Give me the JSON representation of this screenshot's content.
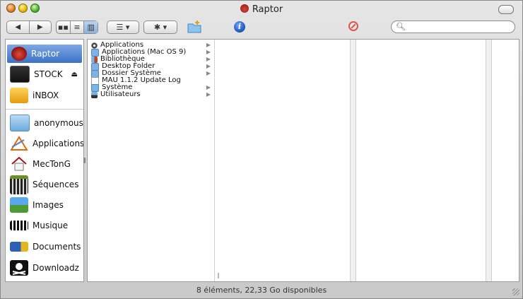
{
  "window": {
    "title": "Raptor"
  },
  "toolbar": {
    "back_icon": "back-arrow-icon",
    "forward_icon": "forward-arrow-icon",
    "view_icons": [
      "icon-view-icon",
      "list-view-icon",
      "column-view-icon"
    ],
    "search": {
      "value": "",
      "placeholder": ""
    }
  },
  "sidebar": {
    "items": [
      {
        "label": "Raptor",
        "icon": "hard-disk-icon",
        "selected": true
      },
      {
        "label": "STOCK",
        "icon": "external-drive-icon",
        "eject": true
      },
      {
        "label": "iNBOX",
        "icon": "inbox-icon"
      },
      {
        "label": "anonymous",
        "icon": "home-folder-icon"
      },
      {
        "label": "Applications",
        "icon": "applications-icon"
      },
      {
        "label": "MecTonG",
        "icon": "home-icon"
      },
      {
        "label": "Séquences",
        "icon": "clapper-icon"
      },
      {
        "label": "Images",
        "icon": "landscape-icon"
      },
      {
        "label": "Musique",
        "icon": "piano-icon"
      },
      {
        "label": "Documents",
        "icon": "documents-icon"
      },
      {
        "label": "Downloadz",
        "icon": "skull-icon"
      }
    ]
  },
  "browser": {
    "column1": [
      {
        "label": "Applications",
        "icon": "applications-folder-icon",
        "has_children": true
      },
      {
        "label": "Applications (Mac OS 9)",
        "icon": "folder-icon",
        "has_children": true
      },
      {
        "label": "Bibliothèque",
        "icon": "library-folder-icon",
        "has_children": true
      },
      {
        "label": "Desktop Folder",
        "icon": "folder-icon",
        "has_children": true
      },
      {
        "label": "Dossier Système",
        "icon": "folder-icon",
        "has_children": true
      },
      {
        "label": "MAU 1.1.2 Update Log",
        "icon": "document-icon",
        "has_children": false
      },
      {
        "label": "Système",
        "icon": "folder-icon",
        "has_children": true
      },
      {
        "label": "Utilisateurs",
        "icon": "users-folder-icon",
        "has_children": true
      }
    ]
  },
  "status": {
    "text": "8 éléments, 22,33 Go disponibles"
  },
  "colors": {
    "selection": "#3b72c6",
    "folder": "#7fb2e5"
  }
}
